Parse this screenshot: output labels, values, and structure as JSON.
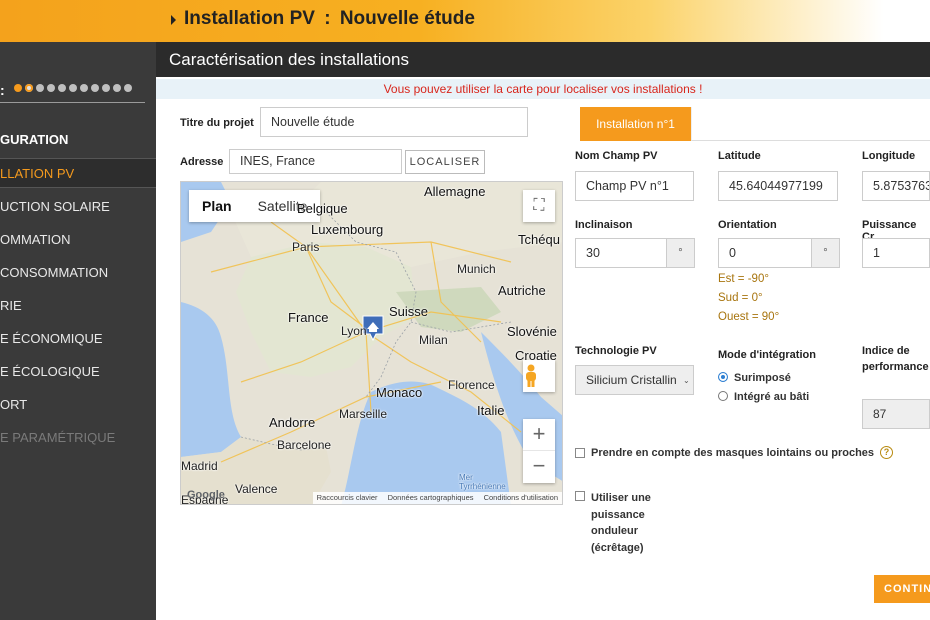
{
  "app": {
    "breadcrumb_prefix": "Installation PV",
    "breadcrumb_sep": ":",
    "breadcrumb_page": "Nouvelle étude"
  },
  "sidebar": {
    "progress_label": ":",
    "step_dots": {
      "total": 11,
      "completed": 1,
      "current": 2
    },
    "items": [
      {
        "label": "GURATION",
        "state": "heading"
      },
      {
        "label": "LLATION PV",
        "state": "active"
      },
      {
        "label": "UCTION SOLAIRE",
        "state": "normal"
      },
      {
        "label": "OMMATION",
        "state": "normal"
      },
      {
        "label": "CONSOMMATION",
        "state": "normal"
      },
      {
        "label": "RIE",
        "state": "normal"
      },
      {
        "label": "E ÉCONOMIQUE",
        "state": "normal"
      },
      {
        "label": "E ÉCOLOGIQUE",
        "state": "normal"
      },
      {
        "label": "ORT",
        "state": "normal"
      },
      {
        "label": "E PARAMÉTRIQUE",
        "state": "disabled"
      }
    ]
  },
  "header": {
    "title": "Caractérisation des installations"
  },
  "notice": "Vous pouvez utiliser la carte pour localiser vos installations !",
  "form": {
    "project_title_label": "Titre du projet",
    "project_title_value": "Nouvelle étude",
    "address_label": "Adresse",
    "address_value": "INES, France",
    "localiser_label": "LOCALISER"
  },
  "map": {
    "type_plan": "Plan",
    "type_satellite": "Satellite",
    "zoom_in": "+",
    "zoom_out": "−",
    "cities": [
      "Allemagne",
      "Belgique",
      "Luxembourg",
      "Tchéqu",
      "Paris",
      "Munich",
      "France",
      "Suisse",
      "Autriche",
      "Lyon",
      "Milan",
      "Slovénie",
      "Croatie",
      "Monaco",
      "Florence",
      "Marseille",
      "Italie",
      "Andorre",
      "Barcelone",
      "Madrid",
      "Valence",
      "Espagne",
      "Mer Tyrrhénienne"
    ],
    "footer": [
      "Raccourcis clavier",
      "Données cartographiques",
      "Conditions d'utilisation"
    ],
    "logo": "Google"
  },
  "installation": {
    "tab_label": "Installation n°1",
    "name_label": "Nom Champ PV",
    "name_value": "Champ PV n°1",
    "latitude_label": "Latitude",
    "latitude_value": "45.64044977199",
    "longitude_label": "Longitude",
    "longitude_value": "5.8753763",
    "inclinaison_label": "Inclinaison",
    "inclinaison_value": "30",
    "inclinaison_unit": "°",
    "orientation_label": "Orientation",
    "orientation_value": "0",
    "orientation_unit": "°",
    "puissance_label": "Puissance Cr",
    "puissance_value": "1",
    "hint_est": "Est = -90°",
    "hint_sud": "Sud = 0°",
    "hint_ouest": "Ouest = 90°",
    "tech_label": "Technologie PV",
    "tech_value": "Silicium Cristallin",
    "mode_label": "Mode d'intégration",
    "mode_option_1": "Surimposé",
    "mode_option_2": "Intégré au bâti",
    "mode_selected": 1,
    "perf_label": "Indice de performance",
    "perf_value": "87",
    "masks_label": "Prendre en compte des masques lointains ou proches",
    "help_icon": "?",
    "inverter_label": "Utiliser une puissance onduleur (écrêtage)",
    "continue_label": "CONTINUER"
  },
  "colors": {
    "accent": "#f59a1d",
    "notice": "#d8261c",
    "hint": "#a8750f",
    "sidebar": "#3a3a3a"
  }
}
